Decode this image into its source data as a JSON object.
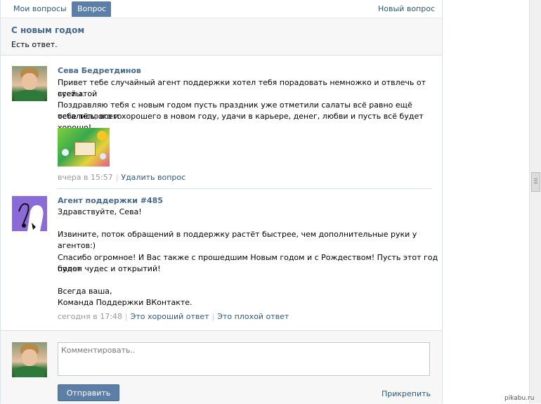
{
  "tabs": {
    "my_questions": "Мои вопросы",
    "question": "Вопрос",
    "new_question": "Новый вопрос"
  },
  "question": {
    "title": "С новым годом",
    "status": "Есть ответ."
  },
  "message1": {
    "author": "Сева Бедретдинов",
    "line1": "Привет тебе случайный агент поддержки хотел тебя порадовать немножко и отвлечь от всей этой",
    "line2": "суеты.",
    "line3": "Поздравляю тебя с новым годом пусть праздник уже отметили салаты всё равно ещё остались, всего",
    "line4": "тебе тёплого и хорошего в новом году, удачи в карьере, денег, любви и пусть всё будет хорошо!",
    "time": "вчера в 15:57",
    "delete": "Удалить вопрос"
  },
  "message2": {
    "author": "Агент поддержки #485",
    "greeting": "Здравствуйте, Сева!",
    "p1": "Извините, поток обращений в поддержку растёт быстрее, чем дополнительные руки у агентов:)",
    "p2a": "Спасибо огромное! И Вас также с прошедшим Новым годом и с Рождеством! Пусть этот год будет",
    "p2b": "полон чудес и открытий!",
    "sign1": "Всегда ваша,",
    "sign2": "Команда Поддержки ВКонтакте.",
    "time": "сегодня в 17:48",
    "good": "Это хороший ответ",
    "bad": "Это плохой ответ"
  },
  "comment": {
    "placeholder": "Комментировать..",
    "send": "Отправить",
    "attach": "Прикрепить"
  },
  "watermark": "pikabu.ru",
  "colors": {
    "accent": "#5b7fa6",
    "link": "#2b587a",
    "author": "#45688e"
  }
}
